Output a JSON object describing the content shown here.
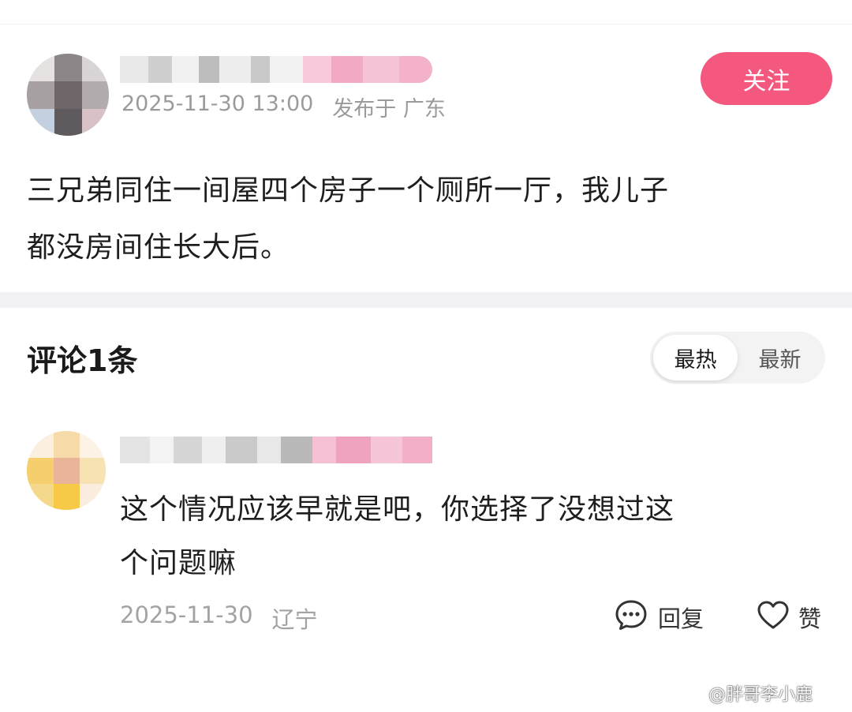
{
  "post": {
    "date": "2025-11-30 13:00",
    "location": "发布于 广东",
    "follow_label": "关注",
    "body_line1": "三兄弟同住一间屋四个房子一个厕所一厅，我儿子",
    "body_line2": "都没房间住长大后。"
  },
  "comments": {
    "title": "评论1条",
    "sort_options": [
      "最热",
      "最新"
    ],
    "items": [
      {
        "body_line1": "这个情况应该早就是吧，你选择了没想过这",
        "body_line2": "个问题嘛",
        "date": "2025-11-30",
        "location": "辽宁",
        "reply_label": "回复",
        "like_label": "赞"
      }
    ]
  },
  "watermark": "@胖哥李小鹿",
  "colors": {
    "accent": "#f4587f",
    "meta_text": "#9b9b9b",
    "divider": "#f2f2f6"
  }
}
